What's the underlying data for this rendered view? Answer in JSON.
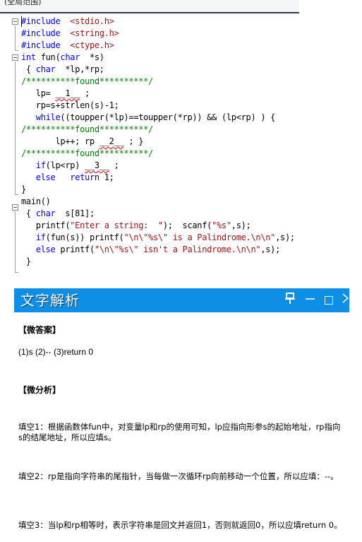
{
  "editor": {
    "scope_label": "(全局范围)",
    "lines": [
      {
        "segments": [
          {
            "t": "#include  ",
            "c": "inc"
          },
          {
            "t": "<stdio.h>",
            "c": "str"
          }
        ]
      },
      {
        "segments": [
          {
            "t": "#include  ",
            "c": "inc"
          },
          {
            "t": "<string.h>",
            "c": "str"
          }
        ]
      },
      {
        "segments": [
          {
            "t": "#include  ",
            "c": "inc"
          },
          {
            "t": "<ctype.h>",
            "c": "str"
          }
        ]
      },
      {
        "segments": [
          {
            "t": "int",
            "c": "kw"
          },
          {
            "t": " fun(",
            "c": ""
          },
          {
            "t": "char",
            "c": "kw"
          },
          {
            "t": "  *s)",
            "c": ""
          }
        ]
      },
      {
        "segments": [
          {
            "t": " { ",
            "c": ""
          },
          {
            "t": "char",
            "c": "kw"
          },
          {
            "t": "  *lp,*rp;",
            "c": ""
          }
        ]
      },
      {
        "segments": [
          {
            "t": "/**********found**********/",
            "c": "cmt"
          }
        ]
      },
      {
        "segments": [
          {
            "t": "   lp= ",
            "c": ""
          },
          {
            "t": "__1__",
            "c": "blank"
          },
          {
            "t": " ;",
            "c": ""
          }
        ]
      },
      {
        "segments": [
          {
            "t": "   rp=s+strlen(s)-1;",
            "c": ""
          }
        ]
      },
      {
        "segments": [
          {
            "t": "   ",
            "c": ""
          },
          {
            "t": "while",
            "c": "kw"
          },
          {
            "t": "((toupper(*lp)==toupper(*rp)) && (lp<rp) ) {",
            "c": ""
          }
        ]
      },
      {
        "segments": [
          {
            "t": "/**********found**********/",
            "c": "cmt"
          }
        ]
      },
      {
        "segments": [
          {
            "t": "       lp++; rp ",
            "c": ""
          },
          {
            "t": "__2__",
            "c": "blank"
          },
          {
            "t": " ; }",
            "c": ""
          }
        ]
      },
      {
        "segments": [
          {
            "t": "/**********found**********/",
            "c": "cmt"
          }
        ]
      },
      {
        "segments": [
          {
            "t": "   ",
            "c": ""
          },
          {
            "t": "if",
            "c": "kw"
          },
          {
            "t": "(lp<rp) ",
            "c": ""
          },
          {
            "t": "__3__",
            "c": "blank"
          },
          {
            "t": " ;",
            "c": ""
          }
        ]
      },
      {
        "segments": [
          {
            "t": "   ",
            "c": ""
          },
          {
            "t": "else",
            "c": "kw"
          },
          {
            "t": "   ",
            "c": ""
          },
          {
            "t": "return",
            "c": "kw"
          },
          {
            "t": " 1;",
            "c": ""
          }
        ]
      },
      {
        "segments": [
          {
            "t": "}",
            "c": ""
          }
        ]
      },
      {
        "segments": [
          {
            "t": "main()",
            "c": ""
          }
        ]
      },
      {
        "segments": [
          {
            "t": " { ",
            "c": ""
          },
          {
            "t": "char",
            "c": "kw"
          },
          {
            "t": "  s[81];",
            "c": ""
          }
        ]
      },
      {
        "segments": [
          {
            "t": "   printf(",
            "c": ""
          },
          {
            "t": "\"Enter a string:  \"",
            "c": "str"
          },
          {
            "t": ");  scanf(",
            "c": ""
          },
          {
            "t": "\"%s\"",
            "c": "str"
          },
          {
            "t": ",s);",
            "c": ""
          }
        ]
      },
      {
        "segments": [
          {
            "t": "   ",
            "c": ""
          },
          {
            "t": "if",
            "c": "kw"
          },
          {
            "t": "(fun(s)) printf(",
            "c": ""
          },
          {
            "t": "\"\\n\\\"%s\\\" is a Palindrome.\\n\\n\"",
            "c": "str"
          },
          {
            "t": ",s);",
            "c": ""
          }
        ]
      },
      {
        "segments": [
          {
            "t": "   ",
            "c": ""
          },
          {
            "t": "else",
            "c": "kw"
          },
          {
            "t": " printf(",
            "c": ""
          },
          {
            "t": "\"\\n\\\"%s\\\" isn't a Palindrome.\\n\\n\"",
            "c": "str"
          },
          {
            "t": ",s);",
            "c": ""
          }
        ]
      },
      {
        "segments": [
          {
            "t": " }",
            "c": ""
          }
        ]
      }
    ]
  },
  "panel": {
    "title": "文字解析",
    "pin_icon": "pin-icon",
    "minimize_icon": "minimize-icon",
    "maximize_icon": "maximize-icon",
    "close_icon": "close-icon",
    "pin_glyph": "中",
    "minimize_glyph": "—",
    "close_glyph": "×"
  },
  "analysis": {
    "answer_heading": "【微答案】",
    "answer_text": "(1)s (2)-- (3)return 0",
    "analysis_heading": "【微分析】",
    "blank1": "填空1：根据函数体fun中，对变量lp和rp的使用可知，lp应指向形参s的起始地址，rp指向s的结尾地址，所以应填s。",
    "blank2": "填空2：rp是指向字符串的尾指针，当每做一次循环rp向前移动一个位置，所以应填：--。",
    "blank3": "填空3：当lp和rp相等时，表示字符串是回文并返回1，否则就返回0，所以应填return 0。"
  }
}
